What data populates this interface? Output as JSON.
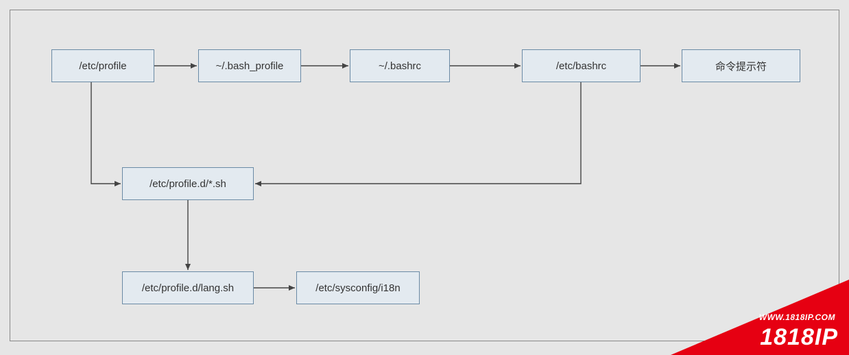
{
  "nodes": {
    "etc_profile": "/etc/profile",
    "bash_profile": "~/.bash_profile",
    "bashrc_home": "~/.bashrc",
    "etc_bashrc": "/etc/bashrc",
    "prompt": "命令提示符",
    "profile_d_sh": "/etc/profile.d/*.sh",
    "profile_d_lang": "/etc/profile.d/lang.sh",
    "sysconfig_i18n": "/etc/sysconfig/i18n"
  },
  "watermark": {
    "url": "WWW.1818IP.COM",
    "brand": "1818IP"
  },
  "chart_data": {
    "type": "diagram",
    "title": "",
    "nodes": [
      {
        "id": "etc_profile",
        "label": "/etc/profile"
      },
      {
        "id": "bash_profile",
        "label": "~/.bash_profile"
      },
      {
        "id": "bashrc_home",
        "label": "~/.bashrc"
      },
      {
        "id": "etc_bashrc",
        "label": "/etc/bashrc"
      },
      {
        "id": "prompt",
        "label": "命令提示符"
      },
      {
        "id": "profile_d_sh",
        "label": "/etc/profile.d/*.sh"
      },
      {
        "id": "profile_d_lang",
        "label": "/etc/profile.d/lang.sh"
      },
      {
        "id": "sysconfig_i18n",
        "label": "/etc/sysconfig/i18n"
      }
    ],
    "edges": [
      {
        "from": "etc_profile",
        "to": "bash_profile"
      },
      {
        "from": "bash_profile",
        "to": "bashrc_home"
      },
      {
        "from": "bashrc_home",
        "to": "etc_bashrc"
      },
      {
        "from": "etc_bashrc",
        "to": "prompt"
      },
      {
        "from": "etc_profile",
        "to": "profile_d_sh"
      },
      {
        "from": "etc_bashrc",
        "to": "profile_d_sh"
      },
      {
        "from": "profile_d_sh",
        "to": "profile_d_lang"
      },
      {
        "from": "profile_d_lang",
        "to": "sysconfig_i18n"
      }
    ]
  }
}
